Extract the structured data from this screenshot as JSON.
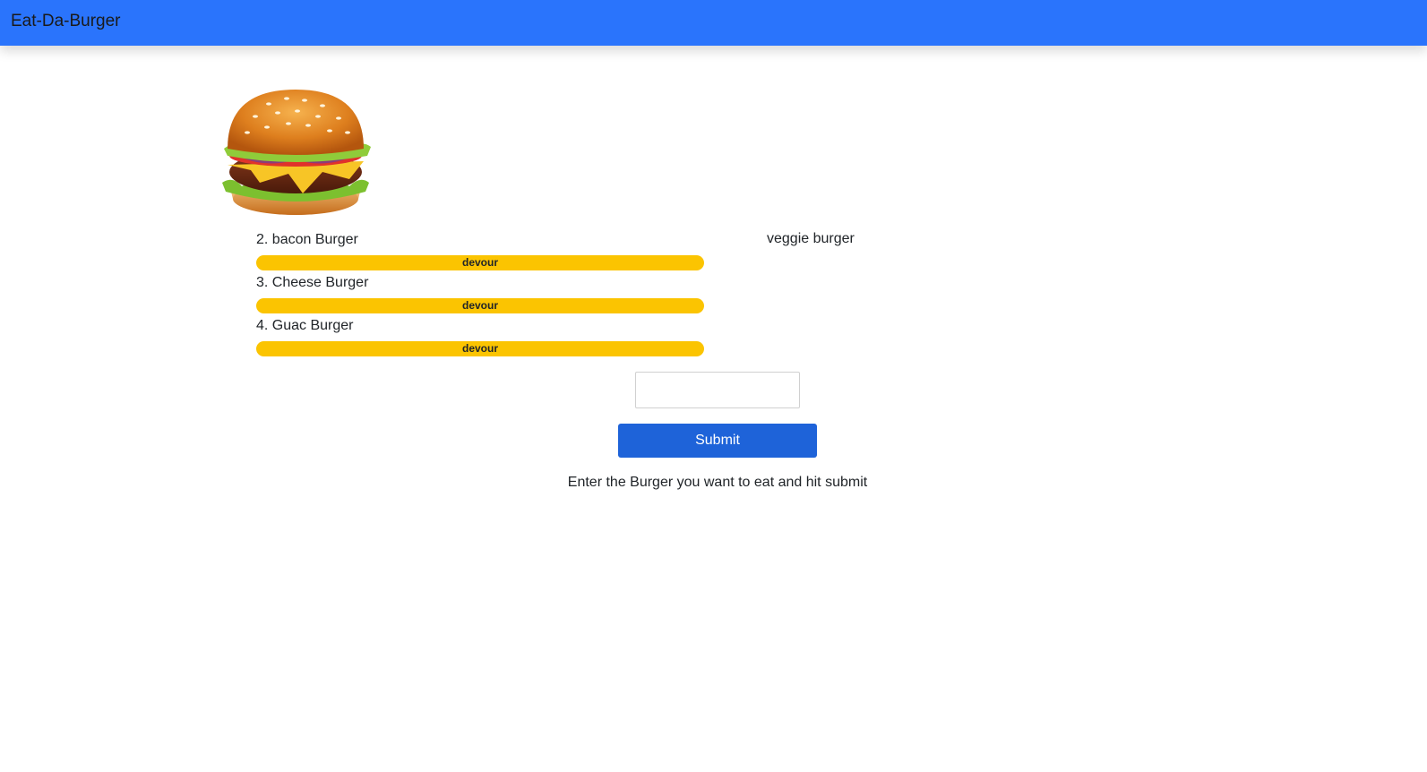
{
  "navbar": {
    "brand": "Eat-Da-Burger",
    "color": "#2a74fc"
  },
  "logo": {
    "icon": "burger-icon"
  },
  "burgers_to_eat": [
    {
      "label": "2. bacon Burger",
      "button_label": "devour"
    },
    {
      "label": "3. Cheese Burger",
      "button_label": "devour"
    },
    {
      "label": "4. Guac Burger",
      "button_label": "devour"
    }
  ],
  "devoured": [
    {
      "label": "veggie burger"
    }
  ],
  "form": {
    "input_value": "",
    "submit_label": "Submit",
    "hint": "Enter the Burger you want to eat and hit submit"
  },
  "colors": {
    "devour_button": "#fbc401",
    "submit_button": "#1e63d9"
  }
}
